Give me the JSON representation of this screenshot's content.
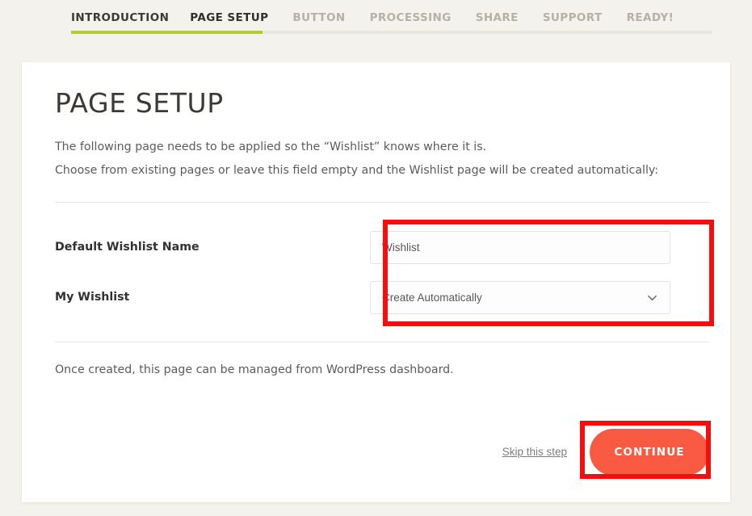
{
  "theme": {
    "page_background": "#f4f2ec",
    "card_background": "#ffffff",
    "progress_accent": "#b5c93a",
    "button_accent": "#fa5a42",
    "annotation_color": "#f60d0d"
  },
  "wizard": {
    "tabs": [
      {
        "label": "INTRODUCTION",
        "state": "done"
      },
      {
        "label": "PAGE SETUP",
        "state": "active"
      },
      {
        "label": "BUTTON",
        "state": "upcoming"
      },
      {
        "label": "PROCESSING",
        "state": "upcoming"
      },
      {
        "label": "SHARE",
        "state": "upcoming"
      },
      {
        "label": "SUPPORT",
        "state": "upcoming"
      },
      {
        "label": "READY!",
        "state": "upcoming"
      }
    ],
    "progress_percent": 30
  },
  "main": {
    "title": "PAGE SETUP",
    "intro_line_1": "The following page needs to be applied so the “Wishlist” knows where it is.",
    "intro_line_2": "Choose from existing pages or leave this field empty and the Wishlist page will be created automatically:",
    "note": "Once created, this page can be managed from WordPress dashboard."
  },
  "form": {
    "default_name": {
      "label": "Default Wishlist Name",
      "value": "Wishlist",
      "placeholder": "Wishlist"
    },
    "my_wishlist": {
      "label": "My Wishlist",
      "selected": "Create Automatically",
      "chevron_icon": "chevron-down-icon"
    }
  },
  "actions": {
    "skip_label": "Skip this step",
    "continue_label": "CONTINUE"
  }
}
